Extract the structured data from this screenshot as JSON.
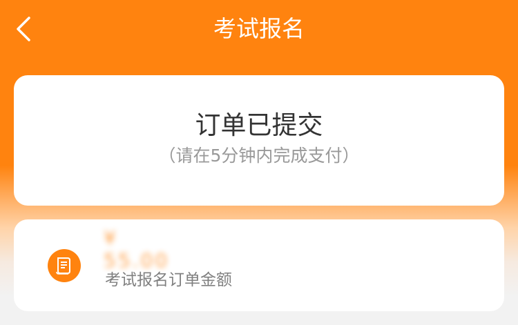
{
  "navbar": {
    "title": "考试报名",
    "back_icon": "chevron-left-icon"
  },
  "status_card": {
    "title": "订单已提交",
    "subtitle": "（请在5分钟内完成支付）"
  },
  "order_card": {
    "icon": "receipt-icon",
    "amount": "¥ 55.00",
    "description": "考试报名订单金额"
  },
  "colors": {
    "accent": "#FF830F",
    "background": "#F2F2F2",
    "card": "#FFFFFF",
    "title_text": "#333333",
    "secondary_text": "#999999"
  }
}
